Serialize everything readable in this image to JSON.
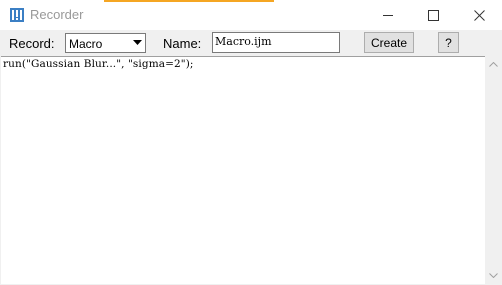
{
  "window": {
    "title": "Recorder",
    "accent_color": "#f5a623",
    "controls": {
      "minimize_icon": "minimize-icon",
      "maximize_icon": "maximize-icon",
      "close_icon": "close-icon"
    }
  },
  "toolbar": {
    "record_label": "Record:",
    "record_selected": "Macro",
    "name_label": "Name:",
    "name_value": "Macro.ijm",
    "create_label": "Create",
    "help_label": "?"
  },
  "editor": {
    "lines": [
      "run(\"Gaussian Blur...\", \"sigma=2\");"
    ]
  }
}
